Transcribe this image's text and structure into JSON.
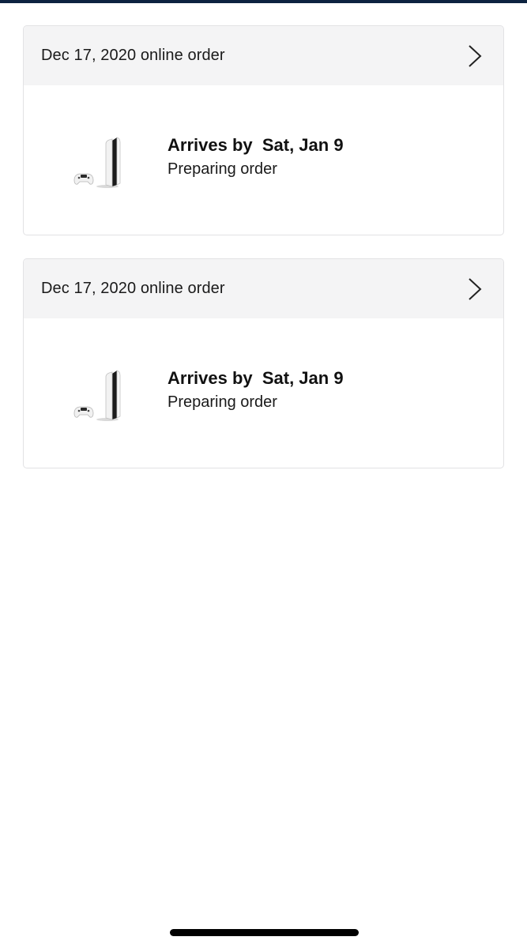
{
  "orders": [
    {
      "header_label": "Dec 17, 2020 online order",
      "arrival_text": "Arrives by  Sat, Jan 9",
      "status": "Preparing order",
      "product_icon": "ps5-console-icon",
      "chevron_icon": "chevron-right-icon"
    },
    {
      "header_label": "Dec 17, 2020 online order",
      "arrival_text": "Arrives by  Sat, Jan 9",
      "status": "Preparing order",
      "product_icon": "ps5-console-icon",
      "chevron_icon": "chevron-right-icon"
    }
  ],
  "colors": {
    "top_bar": "#0d2340",
    "header_bg": "#f4f4f5",
    "card_border": "#e2e2e4",
    "home_indicator": "#000000"
  }
}
